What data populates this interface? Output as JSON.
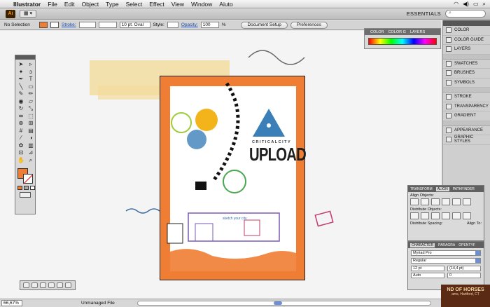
{
  "menubar": {
    "app": "Illustrator",
    "items": [
      "File",
      "Edit",
      "Object",
      "Type",
      "Select",
      "Effect",
      "View",
      "Window",
      "Aiuto"
    ]
  },
  "appbar": {
    "logo": "Ai",
    "workspace": "ESSENTIALS"
  },
  "control": {
    "selection": "No Selection",
    "stroke_label": "Stroke:",
    "brush": "10 pt. Oval",
    "style_label": "Style:",
    "opacity_label": "Opacity:",
    "opacity_value": "100",
    "opacity_unit": "%",
    "doc_setup": "Document Setup",
    "preferences": "Preferences",
    "fill_color": "#ef7d33"
  },
  "color_panel": {
    "tabs": [
      "COLOR",
      "COLOR G",
      "LAYERS"
    ]
  },
  "right_panels": {
    "items": [
      "COLOR",
      "COLOR GUIDE",
      "LAYERS",
      "SWATCHES",
      "BRUSHES",
      "SYMBOLS",
      "STROKE",
      "TRANSPARENCY",
      "GRADIENT",
      "APPEARANCE",
      "GRAPHIC STYLES"
    ]
  },
  "align_panel": {
    "tabs": [
      "TRANSFORM",
      "ALIGN",
      "PATHFINDER"
    ],
    "active_tab": "ALIGN",
    "align_objects": "Align Objects:",
    "distribute_objects": "Distribute Objects:",
    "distribute_spacing": "Distribute Spacing:",
    "align_to": "Align To:"
  },
  "character_panel": {
    "tabs": [
      "CHARACTER",
      "PARAGRA",
      "OPENTYF"
    ],
    "font": "Myriad Pro",
    "style": "Regular",
    "size": "12 pt",
    "leading": "(14,4 pt)",
    "kerning": "Auto",
    "tracking": "0"
  },
  "artwork": {
    "brand": "CRITICALCITY",
    "title": "UPLOAD",
    "caption": "sketch your city",
    "accent": "#ef7d33"
  },
  "status": {
    "zoom": "66,67%",
    "file": "Unmanaged File"
  },
  "sign": {
    "line1": "ND OF HORSES",
    "line2": "ams, Hartford, CT"
  }
}
